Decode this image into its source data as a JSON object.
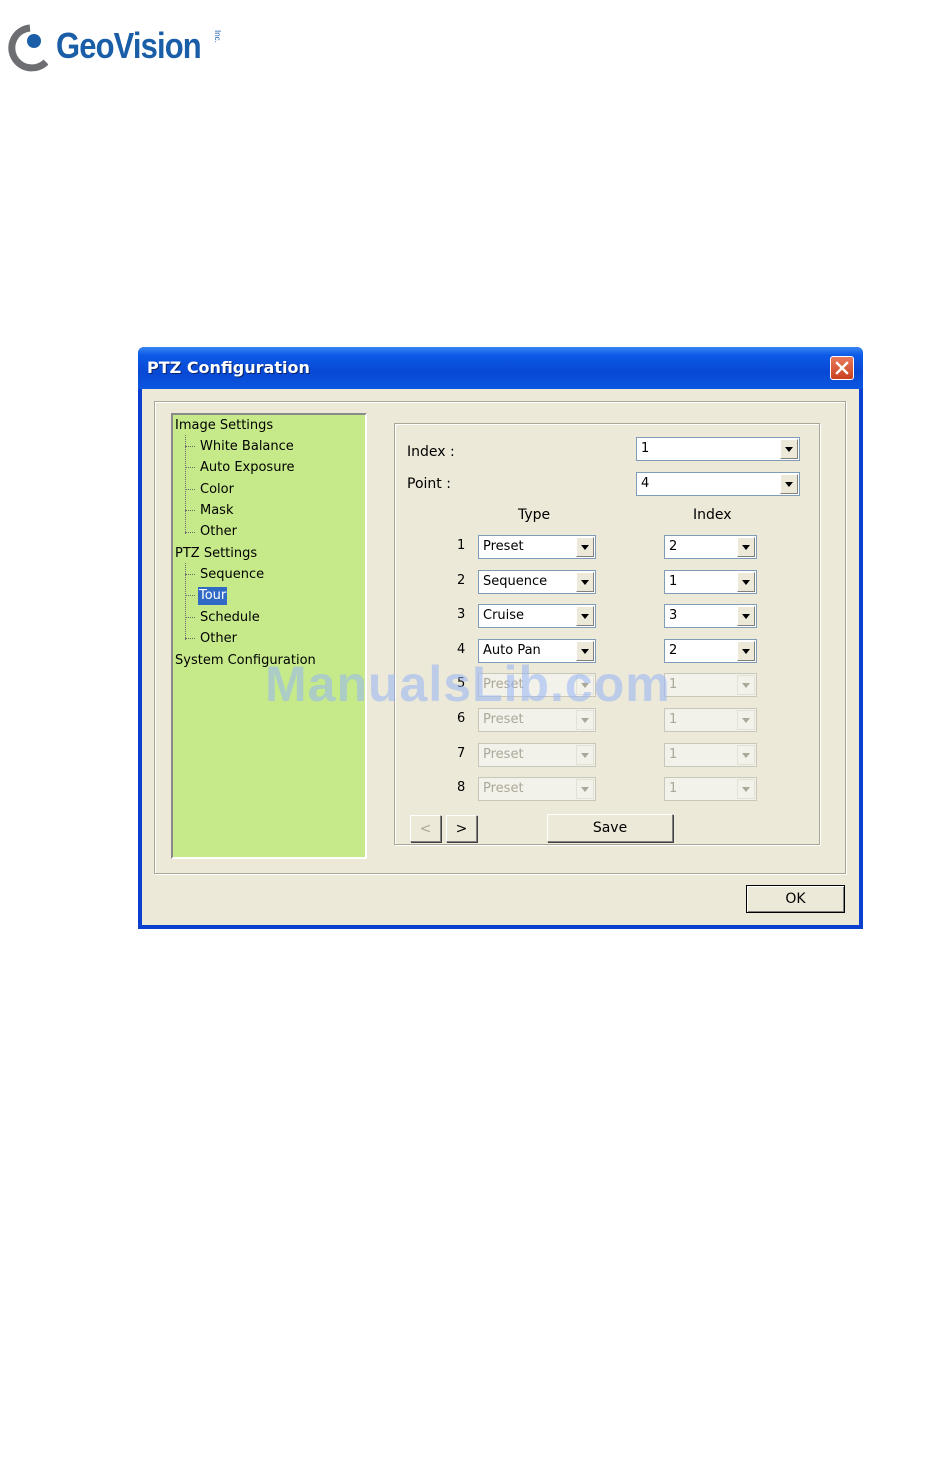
{
  "logo": {
    "text": "GeoVision",
    "suffix": "Inc."
  },
  "window": {
    "title": "PTZ Configuration"
  },
  "tree": {
    "groups": [
      {
        "label": "Image Settings",
        "children": [
          "White Balance",
          "Auto Exposure",
          "Color",
          "Mask",
          "Other"
        ]
      },
      {
        "label": "PTZ Settings",
        "children": [
          "Sequence",
          "Tour",
          "Schedule",
          "Other"
        ]
      },
      {
        "label": "System Configuration",
        "children": []
      }
    ],
    "selected": "Tour"
  },
  "form": {
    "index_label": "Index :",
    "index_value": "1",
    "point_label": "Point :",
    "point_value": "4",
    "type_header": "Type",
    "index_header": "Index",
    "rows": [
      {
        "num": "1",
        "type": "Preset",
        "index": "2",
        "enabled": true
      },
      {
        "num": "2",
        "type": "Sequence",
        "index": "1",
        "enabled": true
      },
      {
        "num": "3",
        "type": "Cruise",
        "index": "3",
        "enabled": true
      },
      {
        "num": "4",
        "type": "Auto Pan",
        "index": "2",
        "enabled": true
      },
      {
        "num": "5",
        "type": "Preset",
        "index": "1",
        "enabled": false
      },
      {
        "num": "6",
        "type": "Preset",
        "index": "1",
        "enabled": false
      },
      {
        "num": "7",
        "type": "Preset",
        "index": "1",
        "enabled": false
      },
      {
        "num": "8",
        "type": "Preset",
        "index": "1",
        "enabled": false
      }
    ],
    "prev_label": "<",
    "next_label": ">",
    "save_label": "Save"
  },
  "footer": {
    "ok_label": "OK"
  },
  "watermark": "ManualsLib.com",
  "colors": {
    "titlebar": "#0848d4",
    "tree_bg": "#c6ea8a",
    "selection": "#316ac5",
    "dialog_bg": "#ece9d8"
  }
}
